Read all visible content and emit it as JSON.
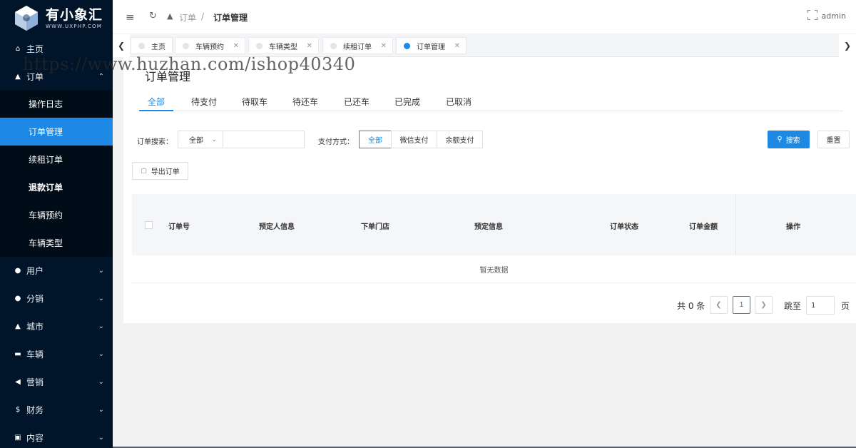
{
  "app": {
    "logo_title": "有小象汇",
    "logo_sub": "WWW.UXPHP.COM"
  },
  "sidebar": {
    "items": [
      {
        "label": "主页",
        "icon": "home-icon"
      },
      {
        "label": "订单",
        "icon": "cart-icon",
        "expanded": true
      },
      {
        "label": "用户",
        "icon": "user-icon"
      },
      {
        "label": "分销",
        "icon": "share-icon"
      },
      {
        "label": "城市",
        "icon": "triangle-icon"
      },
      {
        "label": "车辆",
        "icon": "car-icon"
      },
      {
        "label": "营销",
        "icon": "send-icon"
      },
      {
        "label": "财务",
        "icon": "dollar-icon"
      },
      {
        "label": "内容",
        "icon": "book-icon"
      }
    ],
    "order_sub": [
      "操作日志",
      "订单管理",
      "续租订单",
      "退款订单",
      "车辆预约",
      "车辆类型"
    ]
  },
  "header": {
    "crumb_parent": "订单",
    "crumb_sep": "/",
    "crumb_current": "订单管理",
    "user": "admin"
  },
  "tabs": [
    "主页",
    "车辆预约",
    "车辆类型",
    "续租订单",
    "订单管理"
  ],
  "page": {
    "title": "订单管理",
    "status_tabs": [
      "全部",
      "待支付",
      "待取车",
      "待还车",
      "已还车",
      "已完成",
      "已取消"
    ]
  },
  "filters": {
    "order_search_label": "订单搜索：",
    "order_search_type": "全部",
    "order_search_value": "",
    "pay_label": "支付方式：",
    "pay_options": [
      "全部",
      "微信支付",
      "余额支付"
    ],
    "search_btn": "搜索",
    "reset_btn": "重置",
    "export_btn": "导出订单"
  },
  "table": {
    "columns": [
      "订单号",
      "预定人信息",
      "下单门店",
      "预定信息",
      "订单状态",
      "订单金额",
      "操作"
    ],
    "empty_text": "暂无数据"
  },
  "pagination": {
    "total_text": "共 0 条",
    "current_page": "1",
    "jump_label": "跳至",
    "jump_value": "1",
    "page_unit": "页"
  },
  "watermark": "https://www.huzhan.com/ishop40340",
  "colors": {
    "accent": "#1e88e5",
    "sidebar_bg": "#001529",
    "submenu_bg": "#000c17"
  }
}
